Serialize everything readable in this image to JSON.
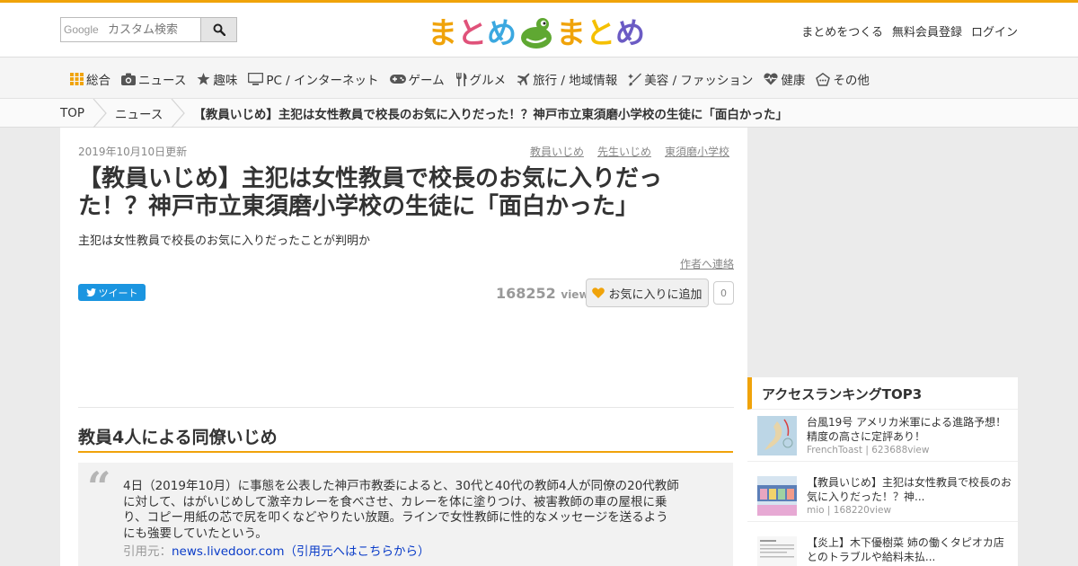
{
  "search": {
    "placeholder": "カスタム検索",
    "brand": "Google"
  },
  "logo": {
    "left": "まとめ",
    "right": "まとめ"
  },
  "colors": {
    "accent": "#f0a30a",
    "tweet": "#1b95e0",
    "link": "#0a3cc8",
    "frog": "#5fa832"
  },
  "usernav": [
    {
      "label": "まとめをつくる"
    },
    {
      "label": "無料会員登録"
    },
    {
      "label": "ログイン"
    }
  ],
  "categories": [
    {
      "label": "総合",
      "icon": "grid-icon"
    },
    {
      "label": "ニュース",
      "icon": "camera-icon"
    },
    {
      "label": "趣味",
      "icon": "star-icon"
    },
    {
      "label": "PC / インターネット",
      "icon": "monitor-icon"
    },
    {
      "label": "ゲーム",
      "icon": "gamepad-icon"
    },
    {
      "label": "グルメ",
      "icon": "utensils-icon"
    },
    {
      "label": "旅行 / 地域情報",
      "icon": "plane-icon"
    },
    {
      "label": "美容 / ファッション",
      "icon": "brush-icon"
    },
    {
      "label": "健康",
      "icon": "heart-pulse-icon"
    },
    {
      "label": "その他",
      "icon": "other-icon"
    }
  ],
  "breadcrumb": [
    {
      "label": "TOP"
    },
    {
      "label": "ニュース"
    },
    {
      "label": "【教員いじめ】主犯は女性教員で校長のお気に入りだった！？神戸市立東須磨小学校の生徒に「面白かった」"
    }
  ],
  "article": {
    "date": "2019年10月10日更新",
    "tags": [
      "教員いじめ",
      "先生いじめ",
      "東須磨小学校"
    ],
    "title": "【教員いじめ】主犯は女性教員で校長のお気に入りだった！？神戸市立東須磨小学校の生徒に「面白かった」",
    "subtitle": "主犯は女性教員で校長のお気に入りだったことが判明か",
    "contact": "作者へ連絡",
    "tweet": "ツイート",
    "views": "168252",
    "views_unit": "view",
    "fav_label": "お気に入りに追加",
    "fav_count": "0",
    "heading": "教員4人による同僚いじめ",
    "quote": "4日（2019年10月）に事態を公表した神戸市教委によると、30代と40代の教師4人が同僚の20代教師に対して、はがいじめして激辛カレーを食べさせ、カレーを体に塗りつけ、被害教師の車の屋根に乗り、コピー用紙の芯で尻を叩くなどやりたい放題。ラインで女性教師に性的なメッセージを送るようにも強要していたという。",
    "quote_source_prefix": "引用元：",
    "quote_source": "news.livedoor.com（引用元へはこちらから）"
  },
  "ranking": {
    "title": "アクセスランキングTOP3",
    "items": [
      {
        "title": "台風19号 アメリカ米軍による進路予想！精度の高さに定評あり！",
        "meta": "FrenchToast | 623688view"
      },
      {
        "title": "【教員いじめ】主犯は女性教員で校長のお気に入りだった！？神...",
        "meta": "mio | 168220view"
      },
      {
        "title": "【炎上】木下優樹菜 姉の働くタピオカ店とのトラブルや給料未払...",
        "meta": ""
      }
    ]
  }
}
